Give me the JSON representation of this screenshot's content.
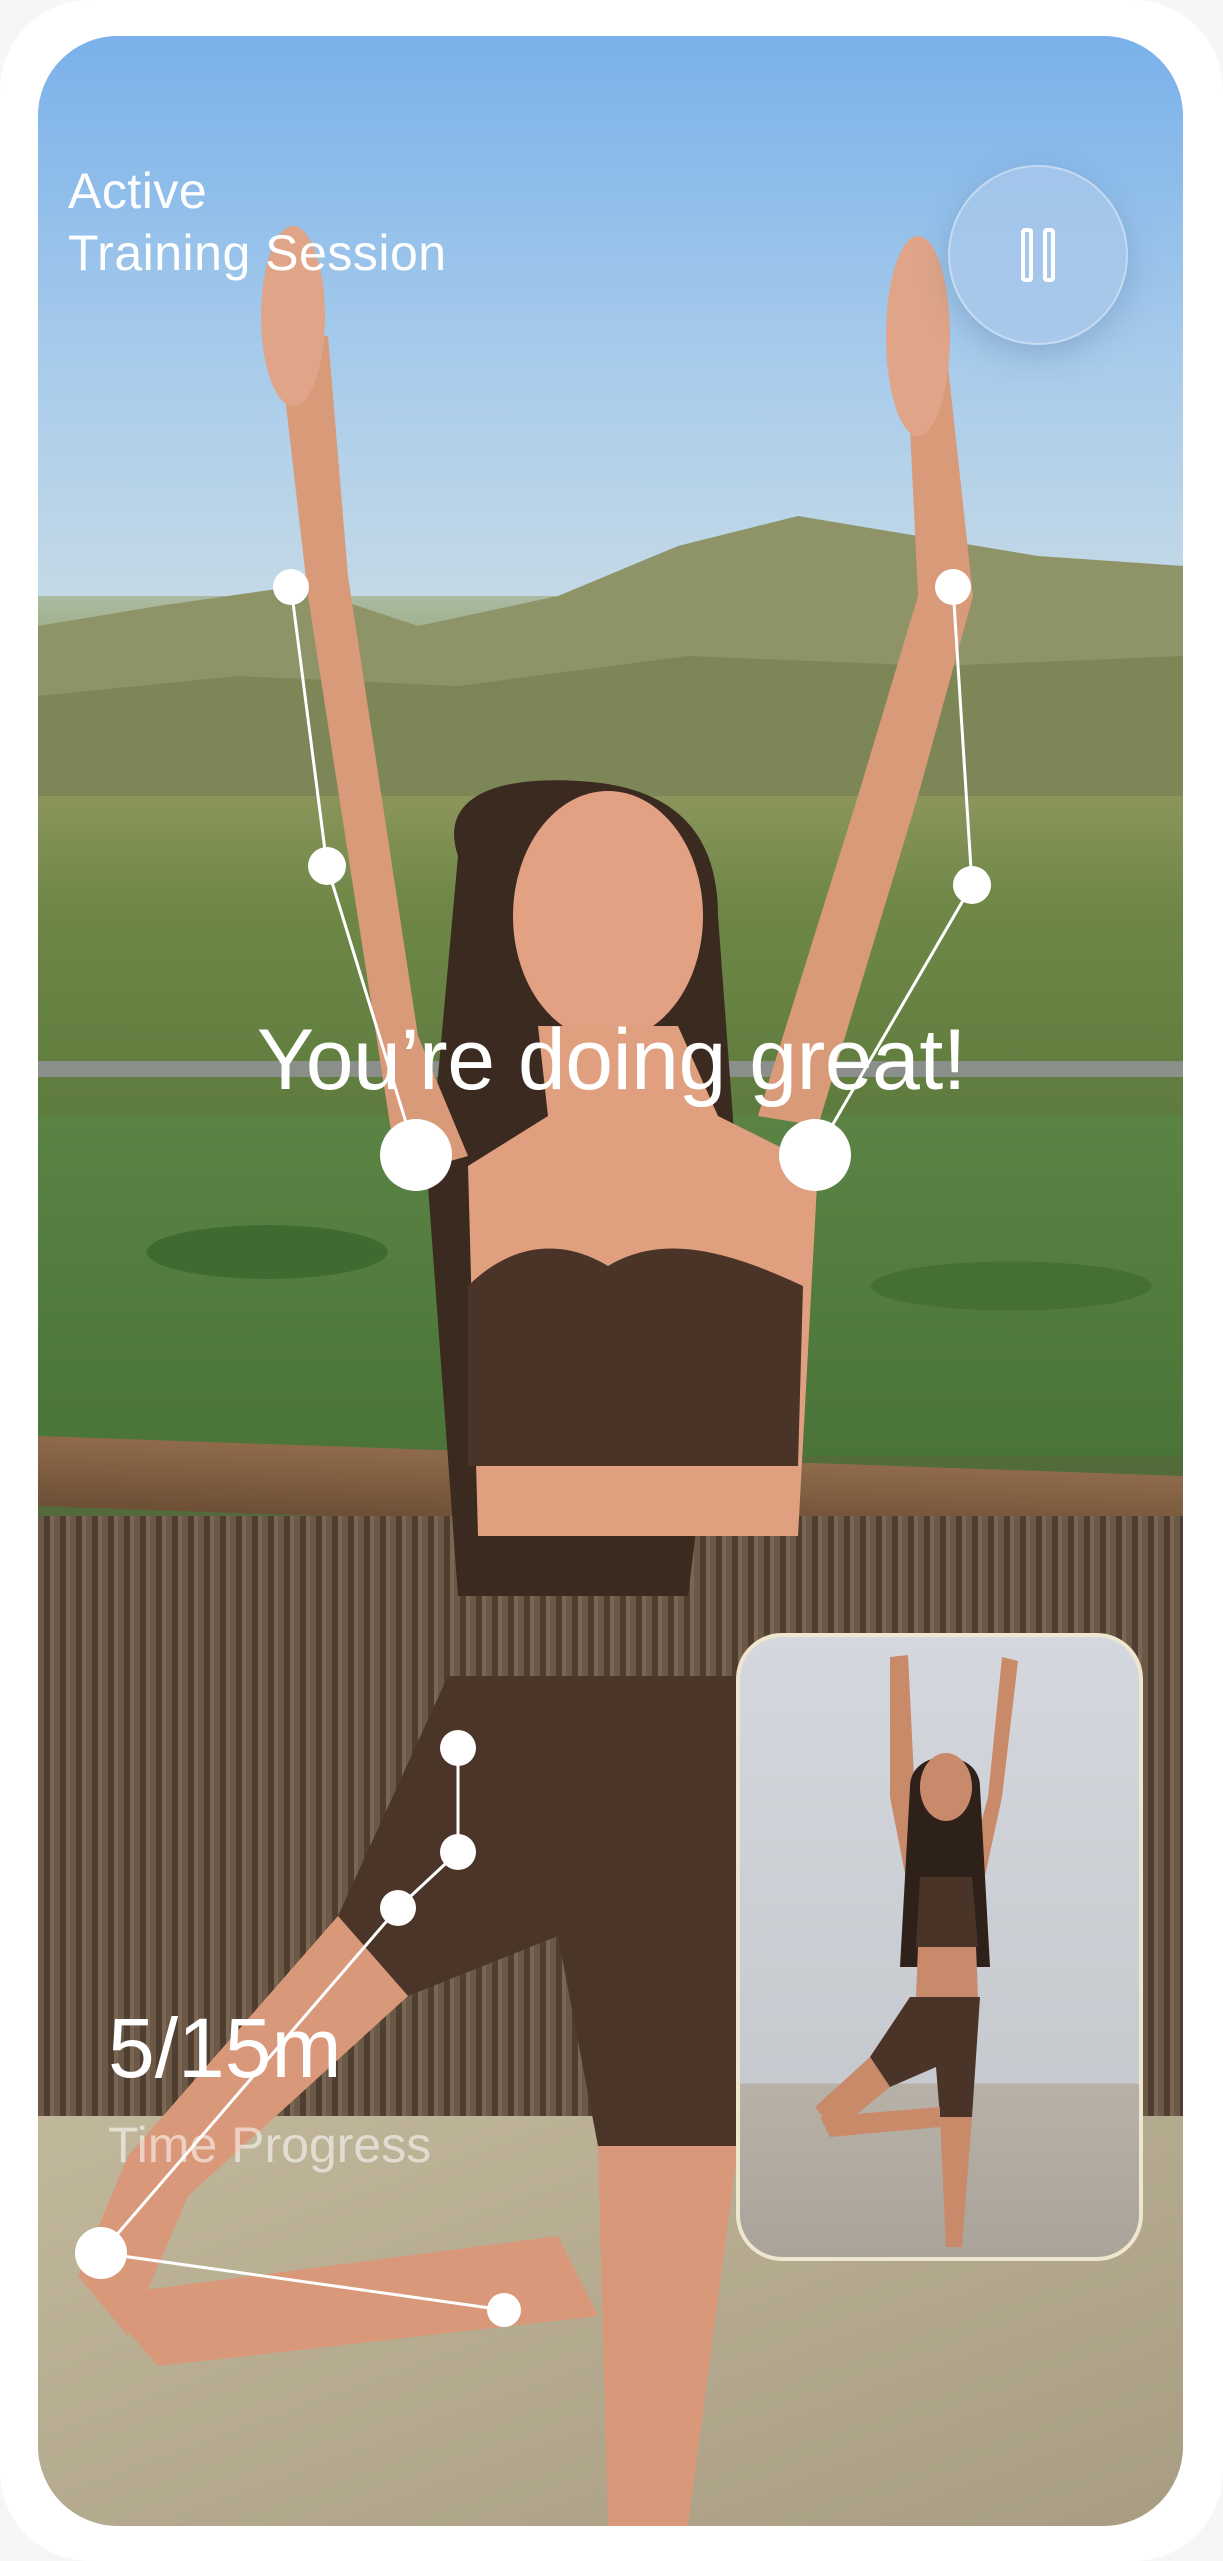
{
  "header": {
    "title_line1": "Active",
    "title_line2": "Training Session"
  },
  "controls": {
    "pause_icon": "pause-icon"
  },
  "feedback": {
    "message": "You’re doing great!"
  },
  "progress": {
    "value": "5/15m",
    "label": "Time Progress"
  },
  "reference": {
    "pose_icon": "reference-pose-thumbnail"
  },
  "colors": {
    "text": "#ffffff",
    "skeleton": "#ffffff",
    "card_border": "#efe6cf",
    "sky": "#7ab1ea"
  }
}
